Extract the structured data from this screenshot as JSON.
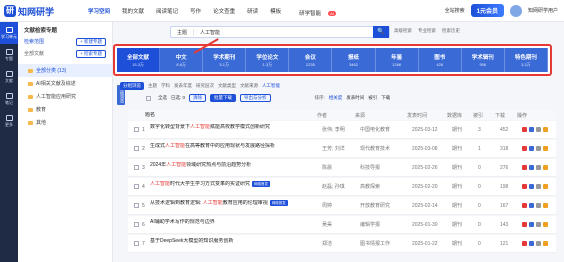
{
  "brand": {
    "name": "知网研学",
    "mark": "研"
  },
  "nav": {
    "items": [
      {
        "label": "学习空间",
        "active": true
      },
      {
        "label": "我的文献"
      },
      {
        "label": "阅读笔记"
      },
      {
        "label": "写作"
      },
      {
        "label": "论文查重"
      },
      {
        "label": "研读"
      },
      {
        "label": "模板"
      },
      {
        "label": "研学智能",
        "badge": "AI"
      }
    ],
    "vip": "1元会员",
    "search_all": "全站搜索",
    "user": "知网研学用户"
  },
  "sidebar": [
    "学习单元",
    "专题",
    "文献",
    "笔记",
    "更多"
  ],
  "left_panel": {
    "title": "文献检索专题",
    "row_left": "检索范围",
    "row_btn": "+ 新建专题",
    "sub_left": "全部文献",
    "sub_btn": "+ 检索专题",
    "tree": [
      {
        "label": "全部分类 (13)",
        "selected": true
      },
      {
        "label": "AI相关文献及综述"
      },
      {
        "label": "人工智能应用研究"
      },
      {
        "label": "教育"
      },
      {
        "label": "其他"
      }
    ]
  },
  "search": {
    "scope": "主题",
    "value": "人工智能",
    "button": "🔍",
    "advanced": "高级检索",
    "expert": "专业检索",
    "history": "检索历史"
  },
  "databases": [
    {
      "name": "全部文献",
      "count": "15.3万",
      "active": true
    },
    {
      "name": "中文",
      "count": "8.6万"
    },
    {
      "name": "学术期刊",
      "count": "5.1万"
    },
    {
      "name": "学位论文",
      "count": "1.3万"
    },
    {
      "name": "会议",
      "count": "2235"
    },
    {
      "name": "报纸",
      "count": "3462"
    },
    {
      "name": "年鉴",
      "count": "1286"
    },
    {
      "name": "图书",
      "count": "428"
    },
    {
      "name": "学术辑刊",
      "count": "956"
    },
    {
      "name": "特色期刊",
      "count": "3.2万"
    }
  ],
  "toolbar": {
    "group": "分组浏览",
    "items": [
      "主题",
      "学科",
      "发表年度",
      "研究层次",
      "文献类型",
      "文献来源"
    ],
    "tag": "人工智能"
  },
  "controls": {
    "side_tag": "分组浏览",
    "select_all": "全选",
    "cleared": "已选: 0",
    "clear": "清除",
    "batch": "批量下载",
    "export": "导出与分析",
    "sort": "排序:",
    "sort_opts": [
      "相关度",
      "发表时间",
      "被引",
      "下载"
    ]
  },
  "table": {
    "headers": [
      "题名",
      "作者",
      "来源",
      "发表时间",
      "数据库",
      "被引",
      "下载",
      "操作"
    ],
    "rows": [
      {
        "n": "1",
        "title_pre": "数字化转型背景下",
        "title_hl": "人工智能",
        "title_post": "赋能高校教学模式创新研究",
        "tag": "",
        "author": "张伟; 李明",
        "source": "中国电化教育",
        "date": "2025-03-12",
        "db": "期刊",
        "cited": "3",
        "dl": "452"
      },
      {
        "n": "2",
        "title_pre": "生成式",
        "title_hl": "人工智能",
        "title_post": "在高等教育中的应用现状与发展路径探析",
        "tag": "",
        "author": "王芳; 刘洋",
        "source": "现代教育技术",
        "date": "2025-03-08",
        "db": "期刊",
        "cited": "1",
        "dl": "318"
      },
      {
        "n": "3",
        "title_pre": "2024年",
        "title_hl": "人工智能",
        "title_post": "领域研究热点与前沿趋势分析",
        "tag": "",
        "author": "陈晨",
        "source": "科技导报",
        "date": "2025-02-26",
        "db": "期刊",
        "cited": "0",
        "dl": "276"
      },
      {
        "n": "4",
        "title_pre": "",
        "title_hl": "人工智能",
        "title_post": "时代大学生学习方式变革的实证研究",
        "tag": "网络首发",
        "author": "赵磊; 孙琪",
        "source": "高教探索",
        "date": "2025-02-20",
        "db": "期刊",
        "cited": "0",
        "dl": "198"
      },
      {
        "n": "5",
        "title_pre": "从技术逻辑到教育逻辑: ",
        "title_hl": "人工智能",
        "title_post": "教育应用的伦理审视",
        "tag": "网络首发",
        "author": "周婷",
        "source": "开放教育研究",
        "date": "2025-02-14",
        "db": "期刊",
        "cited": "0",
        "dl": "167"
      },
      {
        "n": "6",
        "title_pre": "AI辅助学术写作的规范与边界",
        "title_hl": "",
        "title_post": "",
        "tag": "",
        "author": "吴昊",
        "source": "编辑学报",
        "date": "2025-01-30",
        "db": "期刊",
        "cited": "0",
        "dl": "143"
      },
      {
        "n": "7",
        "title_pre": "",
        "title_hl": "",
        "title_post": "基于DeepSeek大模型的知识服务创新",
        "tag": "",
        "author": "郑洁",
        "source": "图书情报工作",
        "date": "2025-01-22",
        "db": "期刊",
        "cited": "0",
        "dl": "121"
      }
    ]
  },
  "colors": {
    "accent": "#1d4fd8",
    "highlight": "#e53935",
    "sidebar": "#1f2a44"
  }
}
